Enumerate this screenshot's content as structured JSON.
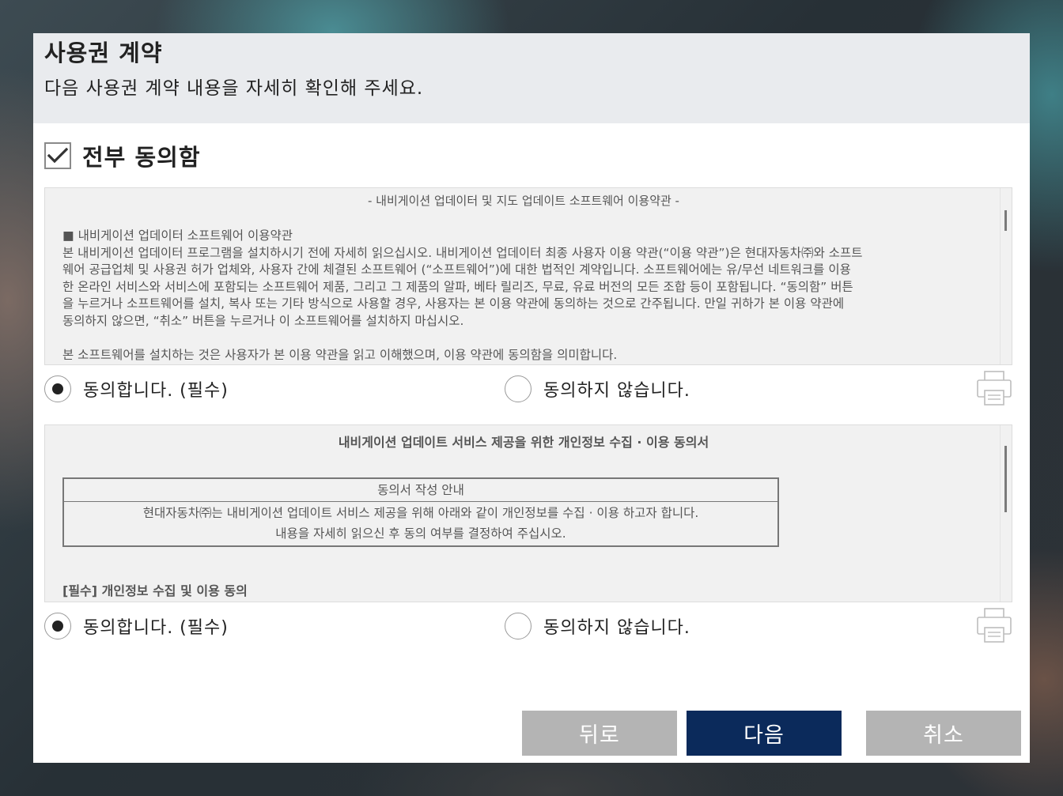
{
  "header": {
    "title": "사용권 계약",
    "subtitle": "다음 사용권 계약 내용을 자세히 확인해 주세요."
  },
  "agree_all": {
    "label": "전부 동의함",
    "checked": true
  },
  "terms1": {
    "heading": "- 내비게이션 업데이터 및 지도 업데이트 소프트웨어 이용약관 -",
    "section_title": "■ 내비게이션 업데이터 소프트웨어 이용약관",
    "lines": [
      "본 내비게이션 업데이터 프로그램을 설치하시기 전에 자세히 읽으십시오. 내비게이션 업데이터 최종 사용자 이용 약관(“이용 약관”)은 현대자동차㈜와 소프트",
      "웨어 공급업체 및 사용권 허가 업체와, 사용자 간에 체결된 소프트웨어 (“소프트웨어”)에 대한 법적인 계약입니다. 소프트웨어에는 유/무선 네트워크를 이용",
      "한 온라인 서비스와 서비스에 포함되는 소프트웨어 제품, 그리고 그 제품의 알파, 베타 릴리즈, 무료, 유료 버전의 모든 조합 등이 포함됩니다. “동의함” 버튼",
      "을 누르거나 소프트웨어를 설치, 복사 또는 기타 방식으로 사용할 경우, 사용자는 본 이용 약관에 동의하는 것으로 간주됩니다. 만일 귀하가 본 이용 약관에",
      "동의하지 않으면, “취소” 버튼을 누르거나 이 소프트웨어를 설치하지 마십시오."
    ],
    "last_line": "본 소프트웨어를 설치하는 것은 사용자가 본 이용 약관을 읽고 이해했으며, 이용 약관에 동의함을 의미합니다."
  },
  "terms2": {
    "heading": "내비게이션 업데이트 서비스 제공을 위한 개인정보 수집 · 이용 동의서",
    "guide_title": "동의서 작성 안내",
    "guide_line1": "현대자동차㈜는 내비게이션 업데이트 서비스 제공을 위해 아래와 같이 개인정보를 수집 · 이용 하고자 합니다.",
    "guide_line2": "내용을 자세히 읽으신 후 동의 여부를 결정하여 주십시오.",
    "section_title": "[필수] 개인정보 수집 및 이용 동의"
  },
  "consent1": {
    "agree_label": "동의합니다. (필수)",
    "disagree_label": "동의하지 않습니다.",
    "selected": "agree"
  },
  "consent2": {
    "agree_label": "동의합니다. (필수)",
    "disagree_label": "동의하지 않습니다.",
    "selected": "agree"
  },
  "buttons": {
    "back": "뒤로",
    "next": "다음",
    "cancel": "취소"
  },
  "colors": {
    "primary_button": "#0b2a5b",
    "secondary_button": "#b4b4b4",
    "header_bg": "#e9ebee",
    "terms_bg": "#f1f1f1"
  },
  "icons": {
    "checkbox": "check-icon",
    "print": "printer-icon"
  }
}
